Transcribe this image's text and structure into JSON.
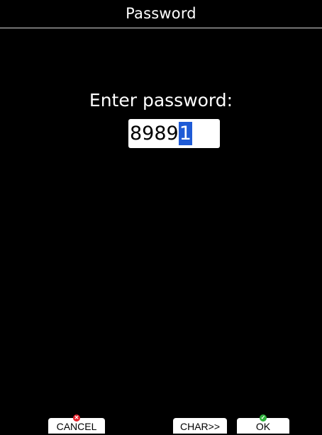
{
  "window": {
    "title": "Password"
  },
  "dialog": {
    "prompt": "Enter password:",
    "password_entered": "8989",
    "password_cursor_char": "1"
  },
  "softkeys": {
    "cancel_label": "CANCEL",
    "char_label": "CHAR>>",
    "ok_label": "OK"
  },
  "icons": {
    "cancel": "red-x-icon",
    "ok": "green-check-icon"
  },
  "colors": {
    "background": "#000000",
    "field_background": "#ffffff",
    "cursor_highlight": "#1f5bd6",
    "cancel_icon": "#e5202a",
    "ok_icon": "#2fb13c"
  }
}
